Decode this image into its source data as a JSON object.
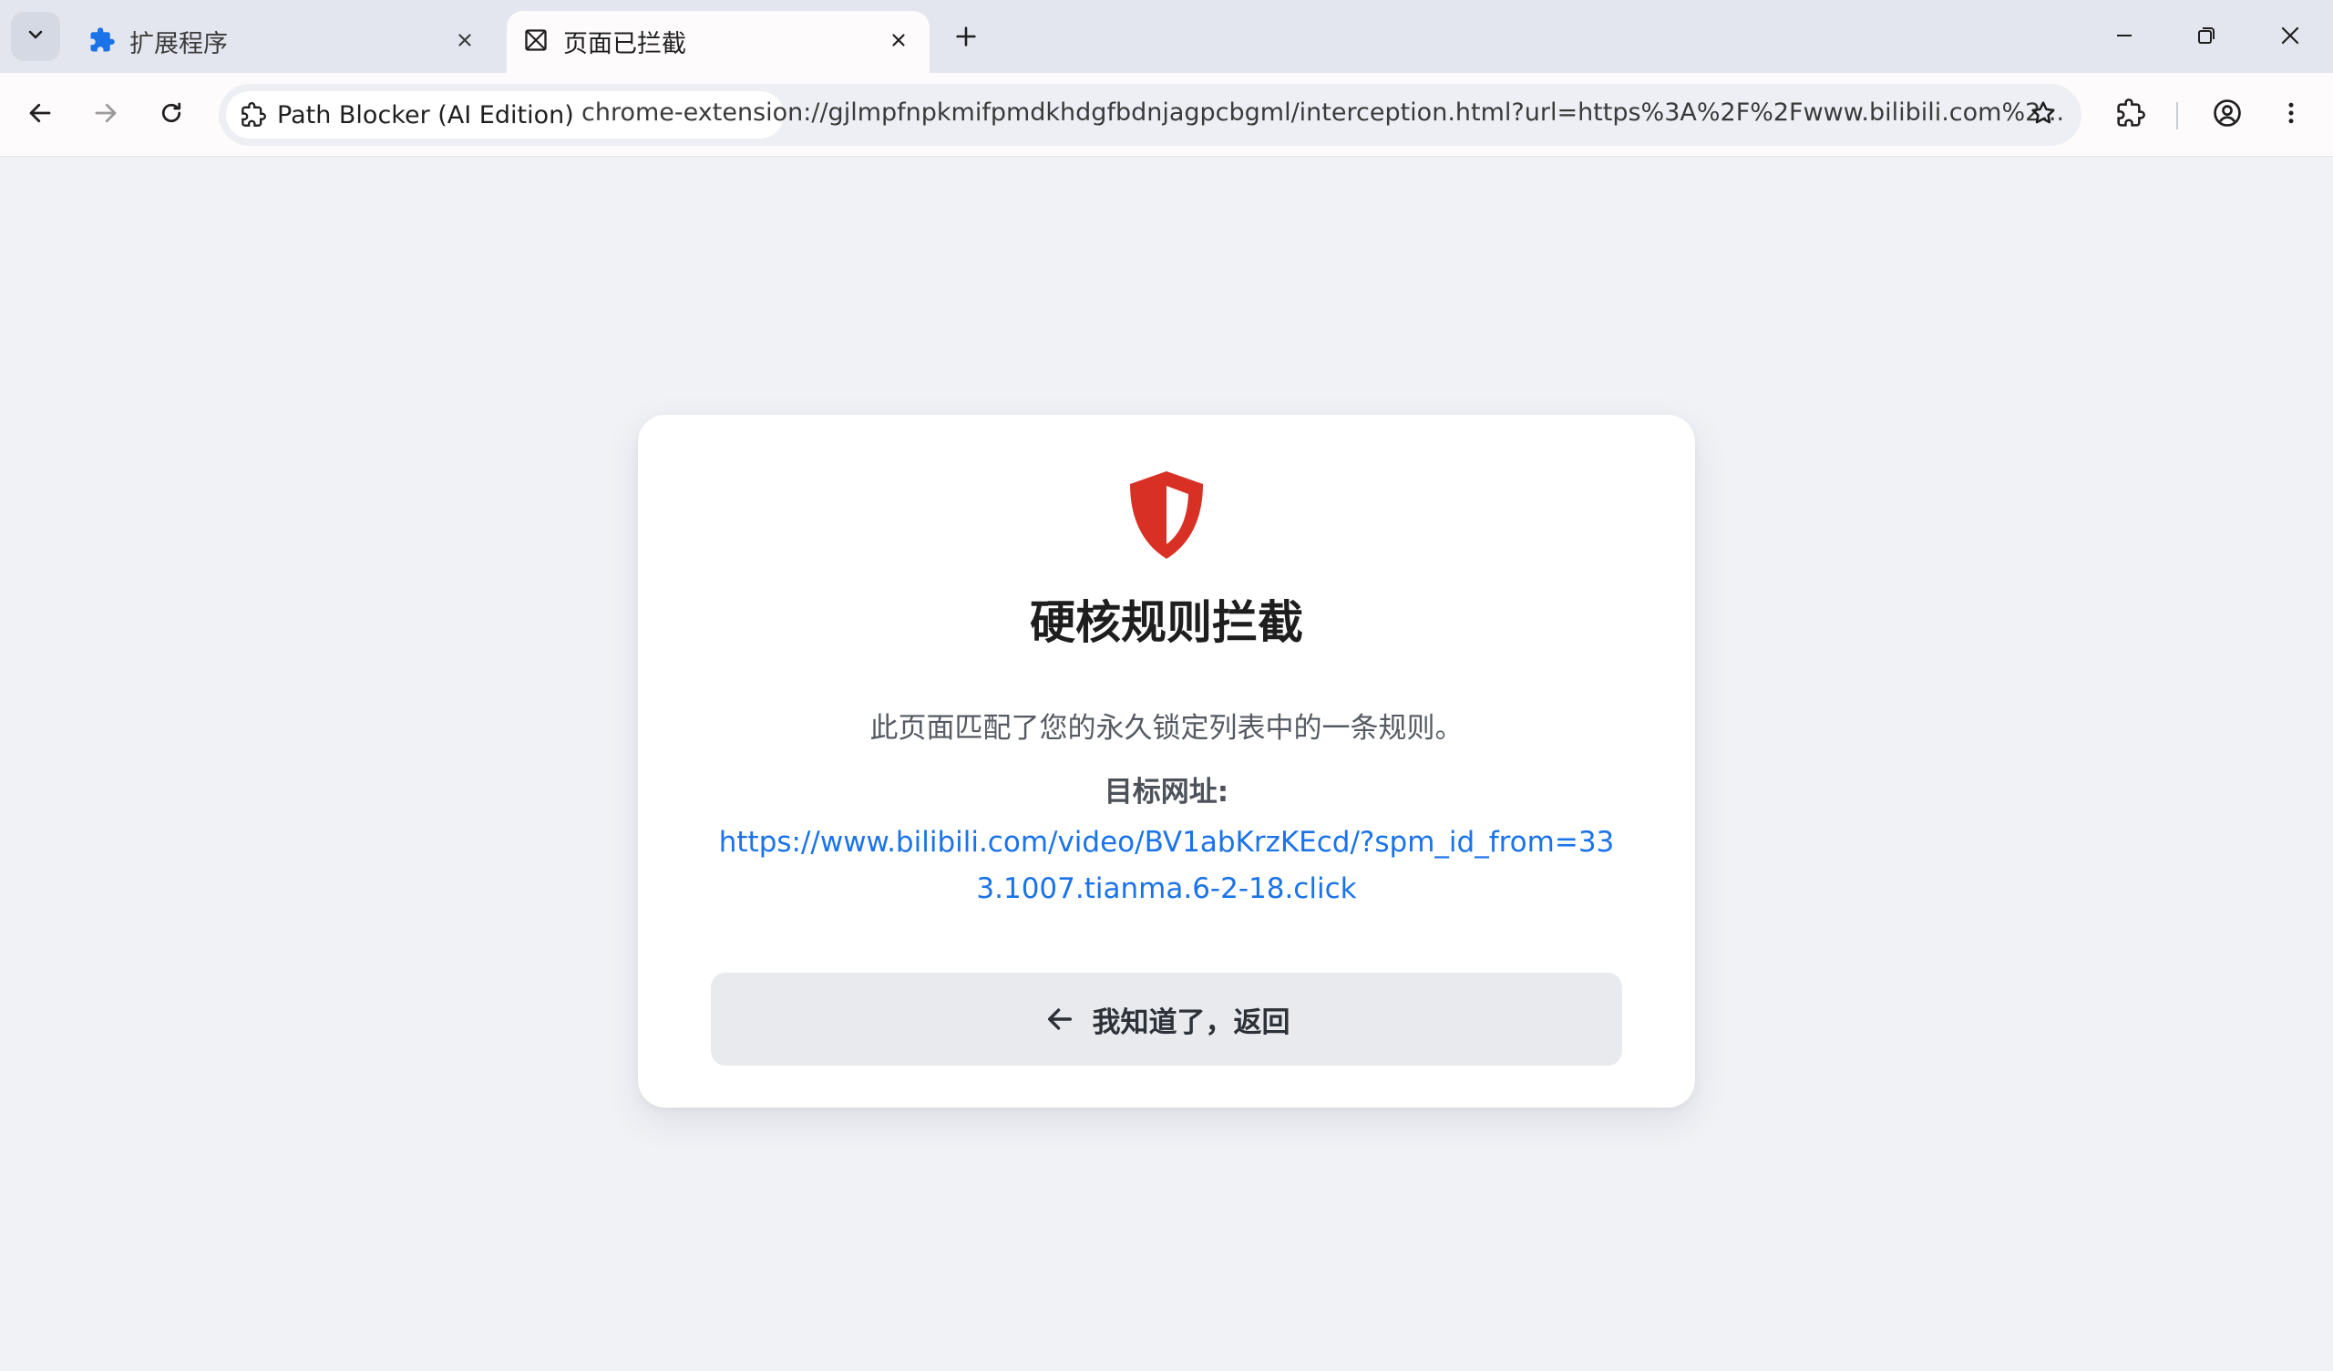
{
  "colors": {
    "accent_link": "#1a73e8",
    "shield_red": "#d93025",
    "tab_strip": "#e3e6ee",
    "page_bg": "#f1f2f6"
  },
  "tabs": [
    {
      "title": "扩展程序",
      "icon": "puzzle-icon",
      "active": false
    },
    {
      "title": "页面已拦截",
      "icon": "blocked-page-icon",
      "active": true
    }
  ],
  "omnibox": {
    "site_chip": "Path Blocker (AI Edition)",
    "url": "chrome-extension://gjlmpfnpkmifpmdkhdgfbdnjagpcbgml/interception.html?url=https%3A%2F%2Fwww.bilibili.com%2..."
  },
  "card": {
    "icon": "shield-icon",
    "title": "硬核规则拦截",
    "description": "此页面匹配了您的永久锁定列表中的一条规则。",
    "target_label": "目标网址:",
    "target_url": "https://www.bilibili.com/video/BV1abKrzKEcd/?spm_id_from=333.1007.tianma.6-2-18.click",
    "back_button": "我知道了，返回"
  }
}
